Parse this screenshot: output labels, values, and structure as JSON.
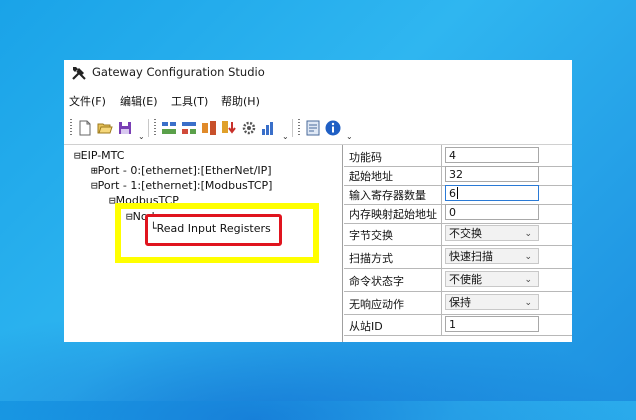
{
  "window": {
    "title": "Gateway Configuration Studio",
    "icon": "tools-icon"
  },
  "menu": {
    "items": [
      {
        "label": "文件(F)"
      },
      {
        "label": "编辑(E)"
      },
      {
        "label": "工具(T)"
      },
      {
        "label": "帮助(H)"
      }
    ]
  },
  "toolbar": {
    "overflow": "⌄"
  },
  "tree": {
    "root": {
      "expander": "⊟",
      "label": "EIP-MTC"
    },
    "port0": {
      "expander": "⊞",
      "label": "Port - 0:[ethernet]:[EtherNet/IP]"
    },
    "port1": {
      "expander": "⊟",
      "label": "Port - 1:[ethernet]:[ModbusTCP]"
    },
    "modbus": {
      "expander": "⊟",
      "label": "ModbusTCP"
    },
    "node": {
      "expander": "⊟",
      "label": "Node"
    },
    "command": {
      "prefix": "└",
      "label": "Read Input Registers"
    }
  },
  "properties": {
    "rows": [
      {
        "label": "功能码",
        "value": "4"
      },
      {
        "label": "起始地址",
        "value": "32"
      },
      {
        "label": "输入寄存器数量",
        "value": "6"
      },
      {
        "label": "内存映射起始地址",
        "value": "0"
      },
      {
        "label": "字节交换",
        "value": "不交换"
      },
      {
        "label": "扫描方式",
        "value": "快速扫描"
      },
      {
        "label": "命令状态字",
        "value": "不使能"
      },
      {
        "label": "无响应动作",
        "value": "保持"
      },
      {
        "label": "从站ID",
        "value": "1"
      }
    ]
  },
  "colors": {
    "highlight_box": "#ffff00",
    "selection_box": "#e0141e"
  }
}
